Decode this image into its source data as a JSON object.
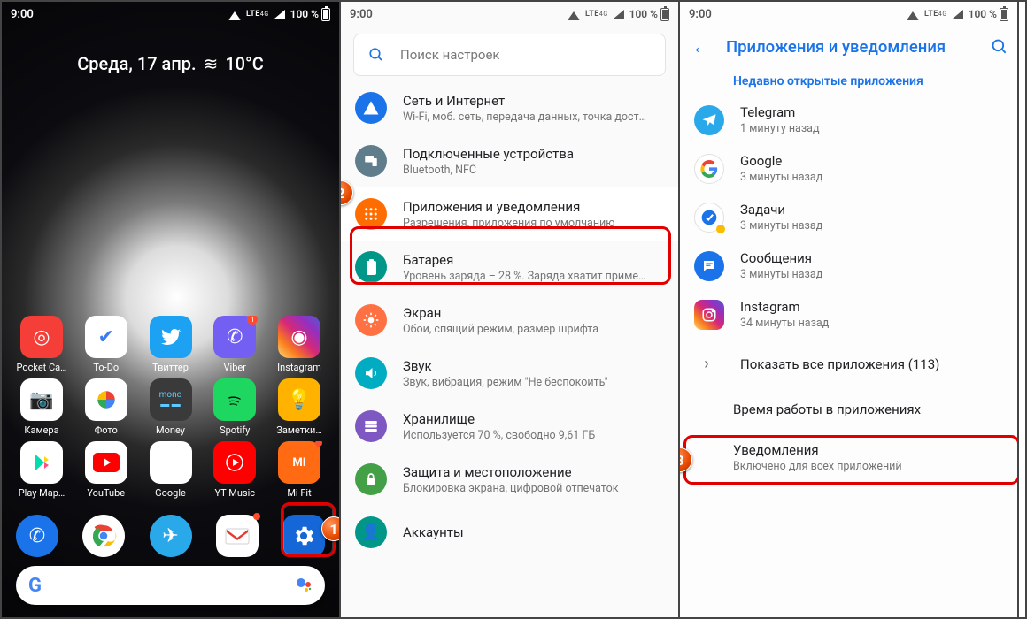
{
  "statusbar": {
    "time": "9:00",
    "net": "LTE",
    "net_sub": "4G",
    "battery": "100 %"
  },
  "screen1": {
    "date": "Среда, 17 апр.",
    "temp": "10°C",
    "apps_row1": [
      {
        "label": "Pocket Ca…"
      },
      {
        "label": "To-Do"
      },
      {
        "label": "Твиттер"
      },
      {
        "label": "Viber"
      },
      {
        "label": "Instagram"
      }
    ],
    "apps_row2": [
      {
        "label": "Камера"
      },
      {
        "label": "Фото"
      },
      {
        "label": "Money"
      },
      {
        "label": "Spotify"
      },
      {
        "label": "Заметки…"
      }
    ],
    "apps_row3": [
      {
        "label": "Play Мар…"
      },
      {
        "label": "YouTube"
      },
      {
        "label": "Google"
      },
      {
        "label": "YT Music"
      },
      {
        "label": "Mi Fit"
      }
    ]
  },
  "screen2": {
    "search_placeholder": "Поиск настроек",
    "items": [
      {
        "title": "Сеть и Интернет",
        "sub": "Wi-Fi, моб. сеть, передача данных, точка дост…",
        "color": "#1a73e8",
        "icon": "◈"
      },
      {
        "title": "Подключенные устройства",
        "sub": "Bluetooth, NFC",
        "color": "#607d8b",
        "icon": "⧉"
      },
      {
        "title": "Приложения и уведомления",
        "sub": "Разрешения, приложения по умолчанию",
        "color": "#ff6d00",
        "icon": "⋮⋮⋮"
      },
      {
        "title": "Батарея",
        "sub": "Уровень заряда – 28 %. Заряда хватит приме…",
        "color": "#009688",
        "icon": "▮"
      },
      {
        "title": "Экран",
        "sub": "Обои, спящий режим, размер шрифта",
        "color": "#ff7043",
        "icon": "✲"
      },
      {
        "title": "Звук",
        "sub": "Звук, вибрация, режим \"Не беспокоить\"",
        "color": "#00acc1",
        "icon": "🔊"
      },
      {
        "title": "Хранилище",
        "sub": "Используется 70 %, свободно 9,61 ГБ",
        "color": "#7e57c2",
        "icon": "≣"
      },
      {
        "title": "Защита и местоположение",
        "sub": "Блокировка экрана, цифровой отпечаток",
        "color": "#43a047",
        "icon": "🔒"
      },
      {
        "title": "Аккаунты",
        "sub": "",
        "color": "#26a69a",
        "icon": "👤"
      }
    ]
  },
  "screen3": {
    "title": "Приложения и уведомления",
    "recent_header": "Недавно открытые приложения",
    "recent": [
      {
        "name": "Telegram",
        "time": "1 минуту назад",
        "color": "#29a9ea",
        "icon": "✈"
      },
      {
        "name": "Google",
        "time": "3 минуты назад",
        "color": "#fff",
        "icon": "G",
        "border": true
      },
      {
        "name": "Задачи",
        "time": "3 минуты назад",
        "color": "#fff",
        "icon": "✔",
        "iconcolor": "#1a73e8",
        "border": true,
        "dotcolor": "#fbbc04"
      },
      {
        "name": "Сообщения",
        "time": "3 минуты назад",
        "color": "#1a73e8",
        "icon": "💬"
      },
      {
        "name": "Instagram",
        "time": "34 минуты назад",
        "color": "linear-gradient(45deg,#feda75,#d62976,#4f5bd5)",
        "icon": "◉",
        "square": true
      }
    ],
    "show_all": "Показать все приложения (113)",
    "sections": [
      {
        "title": "Время работы в приложениях",
        "sub": ""
      },
      {
        "title": "Уведомления",
        "sub": "Включено для всех приложений"
      }
    ]
  },
  "colors": {
    "highlight": "#e10000"
  }
}
